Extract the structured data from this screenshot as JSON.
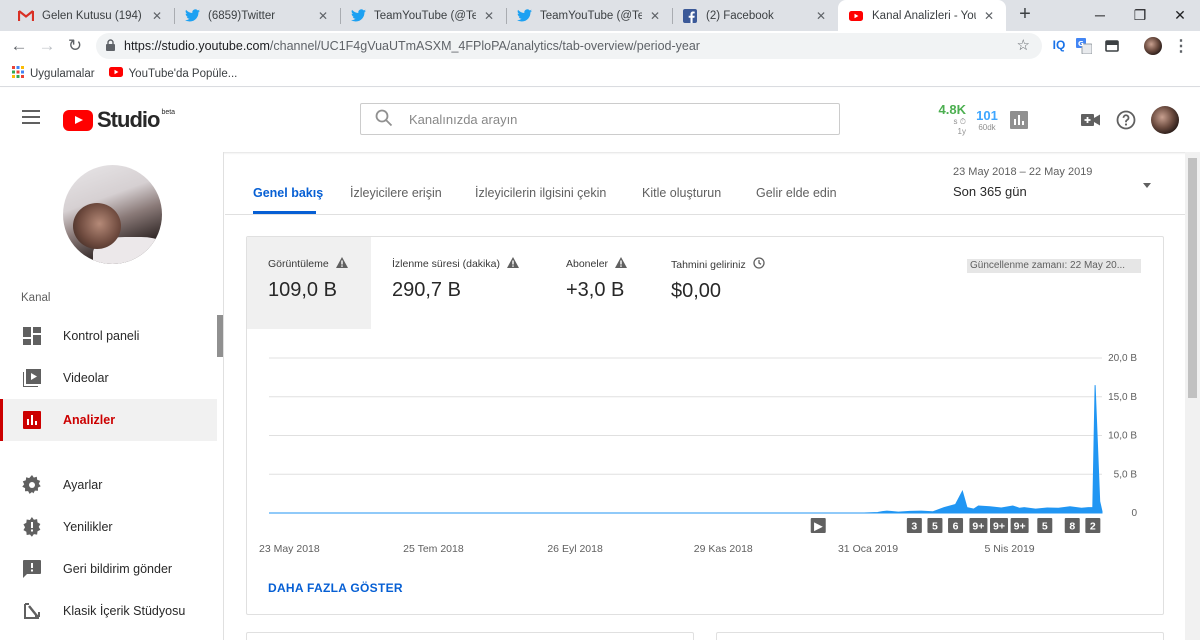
{
  "browser": {
    "tabs": [
      {
        "title": "Gelen Kutusu (194) - se",
        "icon": "gmail-icon"
      },
      {
        "title": "(6859)Twitter",
        "icon": "twitter-icon"
      },
      {
        "title": "TeamYouTube (@TeamY",
        "icon": "twitter-icon"
      },
      {
        "title": "TeamYouTube (@TeamY",
        "icon": "twitter-icon"
      },
      {
        "title": "(2) Facebook",
        "icon": "facebook-icon"
      },
      {
        "title": "Kanal Analizleri - YouTu",
        "icon": "youtube-icon",
        "active": true
      }
    ],
    "url_host": "https://studio.youtube.com",
    "url_path": "/channel/UC1F4gVuaUTmASXM_4FPloPA/analytics/tab-overview/period-year",
    "extensions": [
      "IQ"
    ],
    "bookmarks": [
      {
        "label": "Uygulamalar",
        "icon": "apps-grid-icon"
      },
      {
        "label": "YouTube'da Popüle...",
        "icon": "youtube-icon"
      }
    ]
  },
  "header": {
    "logo_text": "Studio",
    "logo_badge": "beta",
    "search_placeholder": "Kanalınızda arayın",
    "realtime_value": "4.8K",
    "realtime_unit": "s ⏱",
    "realtime_period": "1y",
    "subs_value": "101",
    "subs_period": "60dk"
  },
  "sidebar": {
    "section": "Kanal",
    "items": [
      {
        "label": "Kontrol paneli",
        "icon": "dashboard-icon"
      },
      {
        "label": "Videolar",
        "icon": "videos-icon"
      },
      {
        "label": "Analizler",
        "icon": "analytics-icon",
        "active": true
      },
      {
        "label": "Ayarlar",
        "icon": "settings-gear-icon"
      },
      {
        "label": "Yenilikler",
        "icon": "whats-new-icon"
      },
      {
        "label": "Geri bildirim gönder",
        "icon": "feedback-icon"
      },
      {
        "label": "Klasik İçerik Stüdyosu",
        "icon": "classic-studio-icon"
      }
    ]
  },
  "main": {
    "tabs": [
      "Genel bakış",
      "İzleyicilere erişin",
      "İzleyicilerin ilgisini çekin",
      "Kitle oluşturun",
      "Gelir elde edin"
    ],
    "active_tab": 0,
    "period_range": "23 May 2018 – 22 May 2019",
    "period_label": "Son 365 gün",
    "metrics": [
      {
        "label": "Görüntüleme",
        "value": "109,0 B",
        "icon": "warning-icon",
        "active": true
      },
      {
        "label": "İzlenme süresi (dakika)",
        "value": "290,7 B",
        "icon": "warning-icon"
      },
      {
        "label": "Aboneler",
        "value": "+3,0 B",
        "icon": "warning-icon"
      },
      {
        "label": "Tahmini geliriniz",
        "value": "$0,00",
        "icon": "clock-icon"
      }
    ],
    "updated_text": "Güncellenme zamanı: 22 May 20...",
    "show_more": "DAHA FAZLA GÖSTER"
  },
  "chart_data": {
    "type": "area",
    "color": "#2196f3",
    "y_ticks": [
      "20,0 B",
      "15,0 B",
      "10,0 B",
      "5,0 B",
      "0"
    ],
    "y_tick_values": [
      20000,
      15000,
      10000,
      5000,
      0
    ],
    "ylim": [
      0,
      20000
    ],
    "x_tick_labels": [
      "23 May 2018",
      "25 Tem 2018",
      "26 Eyl 2018",
      "29 Kas 2018",
      "31 Oca 2019",
      "5 Nis 2019"
    ],
    "x_tick_days": [
      0,
      63,
      126,
      190,
      253,
      317
    ],
    "total_days": 364,
    "x": [
      0,
      260,
      266,
      268,
      270,
      275,
      280,
      285,
      290,
      295,
      300,
      303,
      305,
      308,
      310,
      315,
      320,
      325,
      328,
      330,
      335,
      340,
      345,
      350,
      355,
      358,
      360,
      361,
      362,
      363,
      364
    ],
    "y": [
      0,
      0,
      60,
      180,
      250,
      120,
      200,
      250,
      150,
      700,
      1100,
      2800,
      700,
      500,
      900,
      800,
      650,
      900,
      600,
      700,
      500,
      650,
      600,
      800,
      600,
      700,
      700,
      16500,
      9000,
      1500,
      200
    ],
    "markers": [
      {
        "label": "▶",
        "day": 240
      },
      {
        "label": "3",
        "day": 282
      },
      {
        "label": "5",
        "day": 291
      },
      {
        "label": "6",
        "day": 300
      },
      {
        "label": "9+",
        "day": 310
      },
      {
        "label": "9+",
        "day": 319
      },
      {
        "label": "9+",
        "day": 328
      },
      {
        "label": "5",
        "day": 339
      },
      {
        "label": "8",
        "day": 351
      },
      {
        "label": "2",
        "day": 360
      }
    ]
  }
}
